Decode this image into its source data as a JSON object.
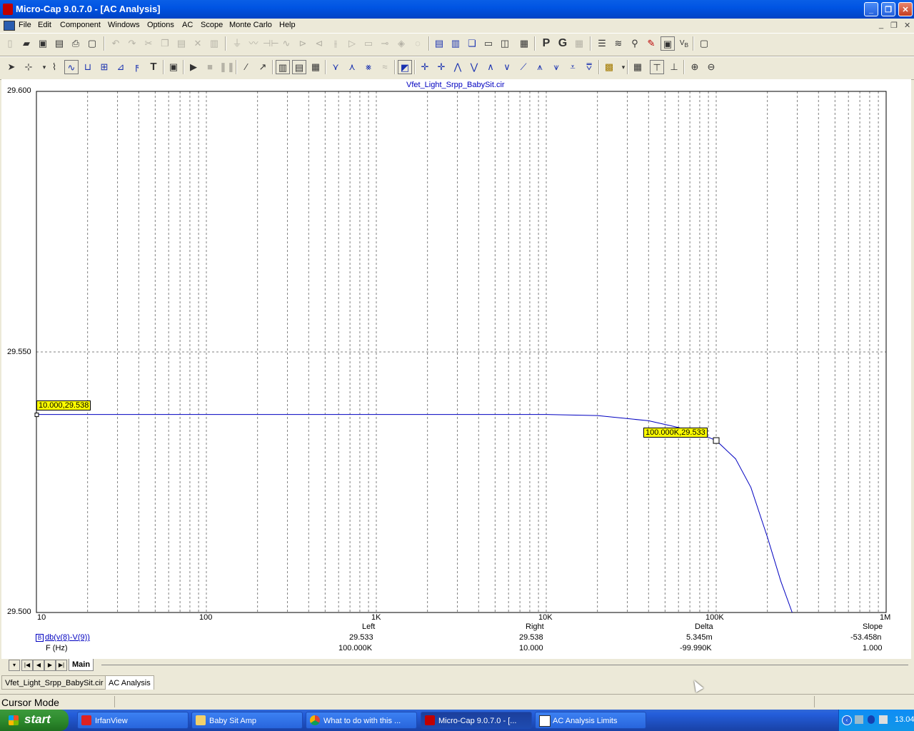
{
  "window": {
    "title": "Micro-Cap 9.0.7.0 - [AC Analysis]"
  },
  "menu": [
    "File",
    "Edit",
    "Component",
    "Windows",
    "Options",
    "AC",
    "Scope",
    "Monte Carlo",
    "Help"
  ],
  "plot": {
    "title": "Vfet_Light_Srpp_BabySit.cir",
    "y_ticks": [
      "29.600",
      "29.550",
      "29.500"
    ],
    "x_ticks": [
      "10",
      "100",
      "1K",
      "10K",
      "100K",
      "1M"
    ],
    "cursor_left_label": "10.000,29.538",
    "cursor_right_label": "100.000K,29.533",
    "curve_color": "#0000c0"
  },
  "chart_data": {
    "type": "line",
    "title": "Vfet_Light_Srpp_BabySit.cir",
    "xscale": "log",
    "xlim": [
      10,
      1000000
    ],
    "ylim": [
      29.5,
      29.6
    ],
    "grid": true,
    "series": [
      {
        "name": "db(v(8)-V(9))",
        "x": [
          10,
          1000,
          10000,
          20000,
          40000,
          60000,
          80000,
          100000,
          130000,
          160000,
          200000,
          240000,
          280000
        ],
        "y": [
          29.538,
          29.538,
          29.538,
          29.5378,
          29.5368,
          29.5355,
          29.5343,
          29.533,
          29.5295,
          29.524,
          29.5145,
          29.506,
          29.5
        ]
      }
    ]
  },
  "readout": {
    "headers": [
      "Left",
      "Right",
      "Delta",
      "Slope"
    ],
    "rows": [
      {
        "name": "db(v(8)-V(9))",
        "values": [
          "29.533",
          "29.538",
          "5.345m",
          "-53.458n"
        ]
      },
      {
        "name": "F (Hz)",
        "values": [
          "100.000K",
          "10.000",
          "-99.990K",
          "1.000"
        ]
      }
    ]
  },
  "tabs": {
    "page_tab": "Main",
    "docs": [
      "Vfet_Light_Srpp_BabySit.cir",
      "AC Analysis"
    ]
  },
  "status": {
    "mode": "Cursor Mode"
  },
  "taskbar": {
    "start": "start",
    "buttons": [
      "IrfanView",
      "Baby Sit Amp",
      "What to do with this ...",
      "Micro-Cap 9.0.7.0 - [...",
      "AC Analysis Limits"
    ],
    "clock": "13.04"
  }
}
